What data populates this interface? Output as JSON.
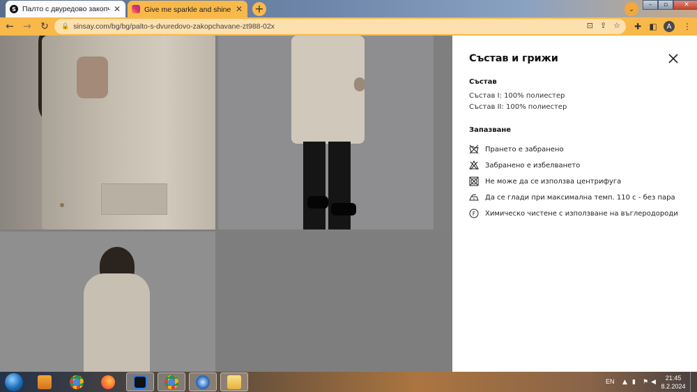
{
  "browser": {
    "tabs": [
      {
        "title": "Палто с двуредово закопчаване",
        "favicon": "sinsay-s-icon",
        "active": true
      },
      {
        "title": "Give me sparkle and shine ✨ • D",
        "favicon": "instagram-icon",
        "active": false
      }
    ],
    "new_tab_label": "+",
    "address": "sinsay.com/bg/bg/palto-s-dvuredovo-zakopchavane-zt988-02x",
    "profile_initial": "A"
  },
  "panel": {
    "title": "Състав и грижи",
    "composition_heading": "Състав",
    "composition_lines": [
      "Състав I: 100% полиестер",
      "Състав II: 100% полиестер"
    ],
    "care_heading": "Запазване",
    "care_items": [
      {
        "icon": "no-wash-icon",
        "text": "Прането е забранено"
      },
      {
        "icon": "no-bleach-icon",
        "text": "Забранено е избелването"
      },
      {
        "icon": "no-tumble-dry-icon",
        "text": "Не може да се използва центрифуга"
      },
      {
        "icon": "iron-icon",
        "text": "Да се глади при максимална темп. 110 с - без пара"
      },
      {
        "icon": "dry-clean-f-icon",
        "text": "Химическо чистене с използване на въглеродороди"
      }
    ]
  },
  "taskbar": {
    "language": "EN",
    "time": "21:45",
    "date": "8.2.2024"
  },
  "colors": {
    "tab_bar_accent": "#f9b84a",
    "omnibox_bg": "#fce0ad",
    "overlay_gray": "#7f7f7f"
  }
}
